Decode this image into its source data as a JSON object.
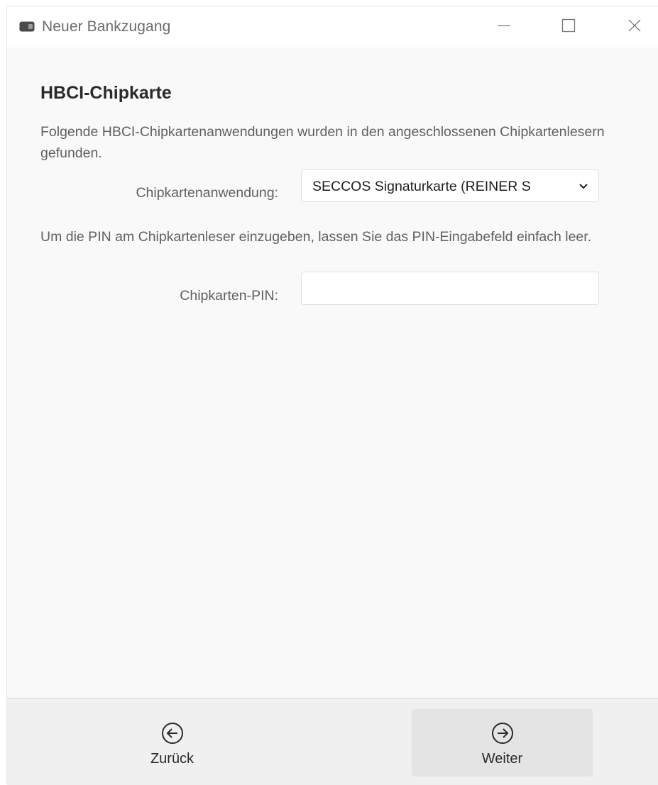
{
  "window": {
    "title": "Neuer Bankzugang",
    "icon": "card-reader-icon",
    "controls": {
      "minimize": "minimize-icon",
      "maximize": "maximize-icon",
      "close": "close-icon"
    }
  },
  "main": {
    "title": "HBCI-Chipkarte",
    "description": "Folgende HBCI-Chipkartenanwendungen wurden in den angeschlossenen Chipkartenlesern gefunden.",
    "application_label": "Chipkartenanwendung:",
    "application_value": "SECCOS Signaturkarte (REINER S",
    "pin_hint": "Um die PIN am Chipkartenleser einzugeben, lassen Sie das PIN-Eingabefeld einfach leer.",
    "pin_label": "Chipkarten-PIN:",
    "pin_value": ""
  },
  "footer": {
    "back_label": "Zurück",
    "back_icon": "arrow-left-circle-icon",
    "next_label": "Weiter",
    "next_icon": "arrow-right-circle-icon"
  },
  "colors": {
    "window_bg": "#f9f9f9",
    "titlebar_bg": "#ffffff",
    "footer_bg": "#f0f0f0",
    "next_button_bg": "#e4e4e4",
    "text_primary": "#2a2a2a",
    "text_secondary": "#606060"
  }
}
